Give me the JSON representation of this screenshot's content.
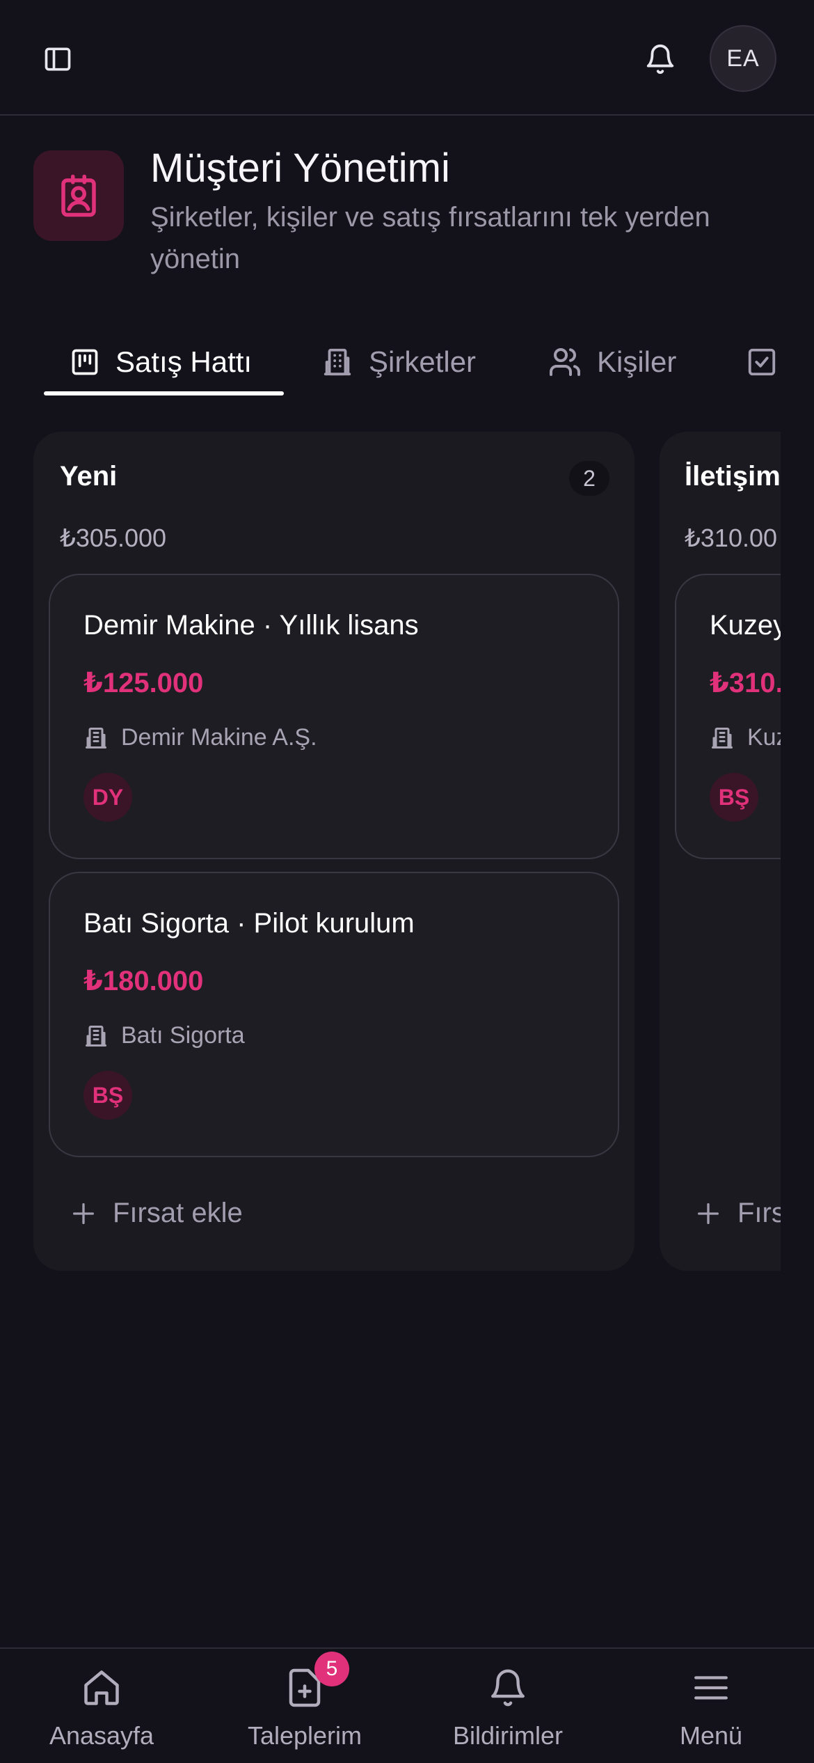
{
  "topbar": {
    "avatar_initials": "EA"
  },
  "header": {
    "title": "Müşteri Yönetimi",
    "subtitle": "Şirketler, kişiler ve satış fırsatlarını tek yerden yönetin"
  },
  "tabs": [
    {
      "label": "Satış Hattı",
      "active": true
    },
    {
      "label": "Şirketler",
      "active": false
    },
    {
      "label": "Kişiler",
      "active": false
    }
  ],
  "columns": [
    {
      "title": "Yeni",
      "count": "2",
      "total": "₺305.000",
      "deals": [
        {
          "title": "Demir Makine · Yıllık lisans",
          "amount": "₺125.000",
          "company": "Demir Makine A.Ş.",
          "owner": "DY"
        },
        {
          "title": "Batı Sigorta · Pilot kurulum",
          "amount": "₺180.000",
          "company": "Batı Sigorta",
          "owner": "BŞ"
        }
      ],
      "add_label": "Fırsat ekle"
    },
    {
      "title": "İletişim",
      "total": "₺310.00",
      "deals": [
        {
          "title": "Kuzey",
          "amount": "₺310.",
          "company": "Kuz",
          "owner": "BŞ"
        }
      ],
      "add_label": "Fırs"
    }
  ],
  "bottom_nav": [
    {
      "label": "Anasayfa",
      "icon": "home-icon"
    },
    {
      "label": "Taleplerim",
      "icon": "file-plus-icon",
      "badge": "5"
    },
    {
      "label": "Bildirimler",
      "icon": "bell-icon"
    },
    {
      "label": "Menü",
      "icon": "menu-icon"
    }
  ],
  "colors": {
    "accent": "#e0317a",
    "background": "#13111a",
    "surface": "#1c1a21"
  }
}
